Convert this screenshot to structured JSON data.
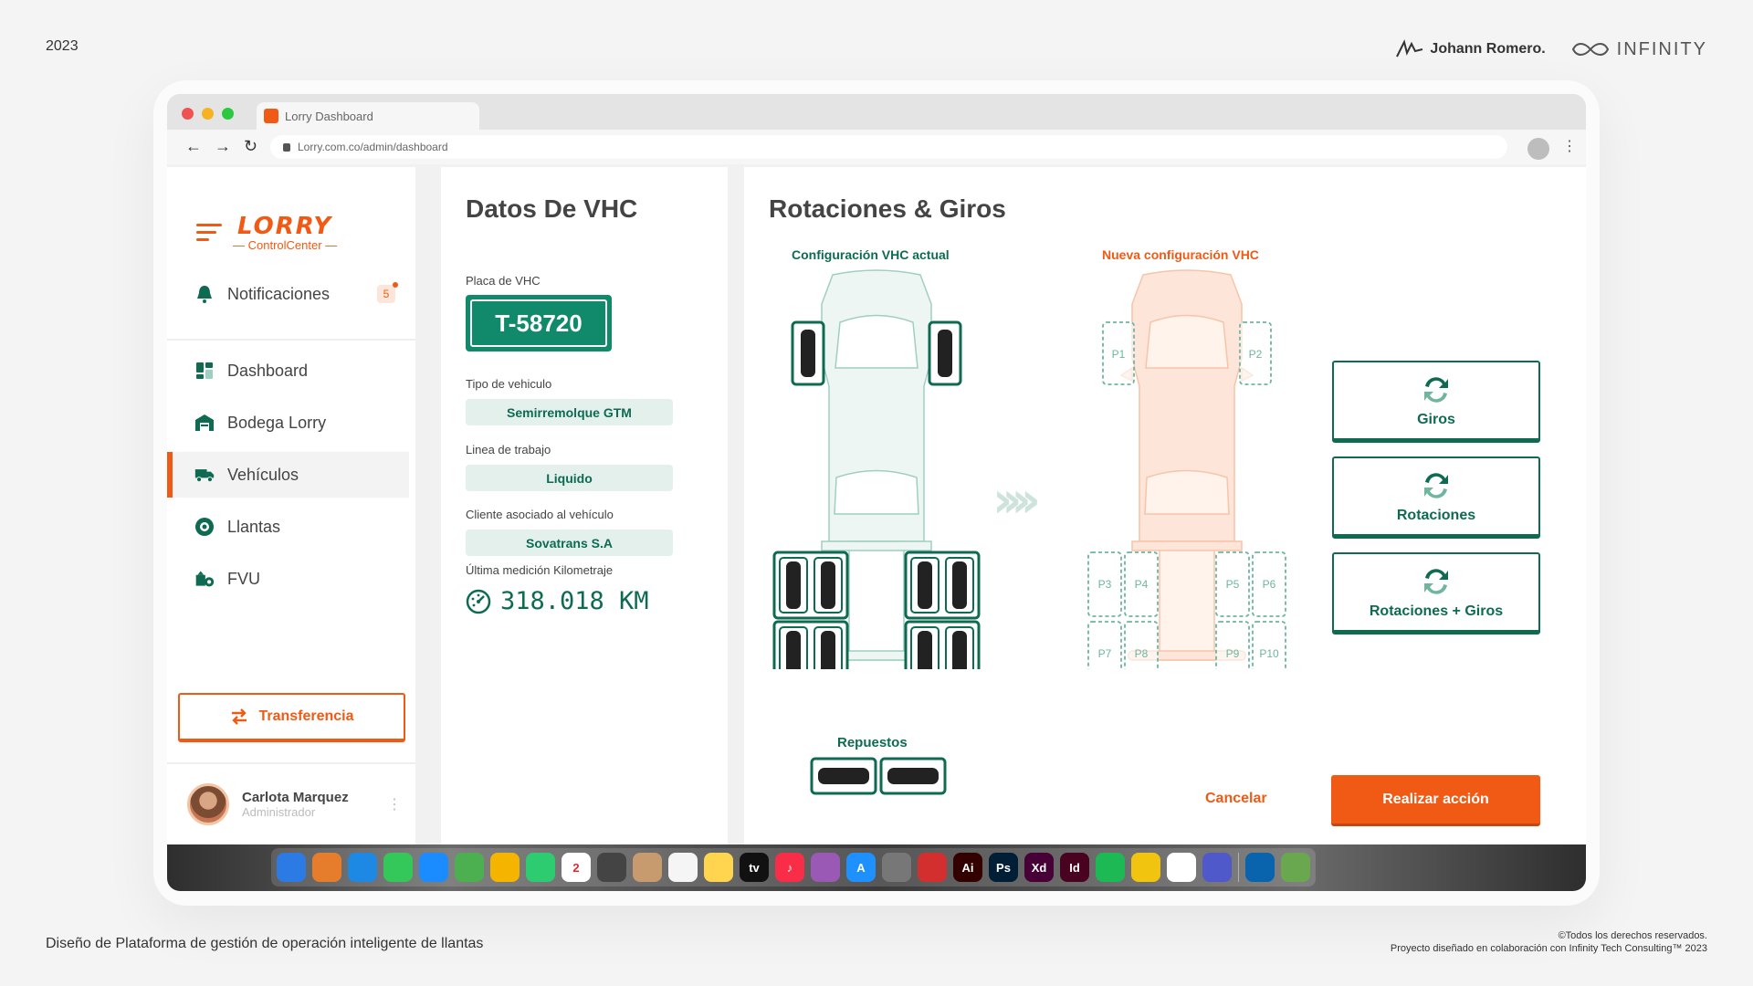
{
  "page": {
    "year": "2023",
    "designer": "Johann Romero.",
    "partner_brand": "INFINITY",
    "footer_left": "Diseño de Plataforma de gestión de operación inteligente de llantas",
    "footer_right_1": "©Todos los derechos reservados.",
    "footer_right_2": "Proyecto diseñado en colaboración con Infinity Tech Consulting™ 2023"
  },
  "browser": {
    "tab_title": "Lorry Dashboard",
    "url": "Lorry.com.co/admin/dashboard"
  },
  "colors": {
    "accent": "#f05a14",
    "green": "#0e6b52",
    "plate": "#108a6a",
    "pill_bg": "#e3f0ec"
  },
  "sidebar": {
    "logo_main": "LORRY",
    "logo_sub": "ControlCenter",
    "notifications_label": "Notificaciones",
    "notifications_count": "5",
    "items": [
      {
        "label": "Dashboard",
        "icon": "dashboard-icon"
      },
      {
        "label": "Bodega Lorry",
        "icon": "warehouse-icon"
      },
      {
        "label": "Vehículos",
        "icon": "truck-icon",
        "active": true
      },
      {
        "label": "Llantas",
        "icon": "tire-icon"
      },
      {
        "label": "FVU",
        "icon": "fvu-icon"
      }
    ],
    "transfer_label": "Transferencia",
    "user_name": "Carlota Marquez",
    "user_role": "Administrador"
  },
  "vhc": {
    "title": "Datos De VHC",
    "plate_label": "Placa de VHC",
    "plate": "T-58720",
    "type_label": "Tipo de vehiculo",
    "type": "Semirremolque GTM",
    "line_label": "Linea de trabajo",
    "line": "Liquido",
    "client_label": "Cliente asociado al vehículo",
    "client": "Sovatrans S.A",
    "km_label": "Última medición Kilometraje",
    "km": "318.018 KM"
  },
  "rotations": {
    "title": "Rotaciones & Giros",
    "current_label": "Configuración VHC actual",
    "new_label": "Nueva configuración VHC",
    "spares_label": "Repuestos",
    "positions": [
      "P1",
      "P2",
      "P3",
      "P4",
      "P5",
      "P6",
      "P7",
      "P8",
      "P9",
      "P10"
    ],
    "actions": [
      "Giros",
      "Rotaciones",
      "Rotaciones + Giros"
    ],
    "cancel_label": "Cancelar",
    "submit_label": "Realizar acción"
  },
  "dock": {
    "apps": [
      {
        "name": "finder",
        "color": "#2c7be5",
        "text": ""
      },
      {
        "name": "launchpad",
        "color": "#e57d2c",
        "text": ""
      },
      {
        "name": "safari",
        "color": "#1e88e5",
        "text": ""
      },
      {
        "name": "messages",
        "color": "#34c759",
        "text": ""
      },
      {
        "name": "mail",
        "color": "#1a8cff",
        "text": ""
      },
      {
        "name": "maps",
        "color": "#4caf50",
        "text": ""
      },
      {
        "name": "photos",
        "color": "#f4b400",
        "text": ""
      },
      {
        "name": "facetime",
        "color": "#2ecc71",
        "text": ""
      },
      {
        "name": "calendar",
        "color": "#ffffff",
        "text": "2"
      },
      {
        "name": "calculator",
        "color": "#444444",
        "text": ""
      },
      {
        "name": "contacts",
        "color": "#c79b6d",
        "text": ""
      },
      {
        "name": "reminders",
        "color": "#f5f5f5",
        "text": ""
      },
      {
        "name": "notes",
        "color": "#ffd54f",
        "text": ""
      },
      {
        "name": "tv",
        "color": "#111111",
        "text": "tv"
      },
      {
        "name": "music",
        "color": "#fa2d48",
        "text": "♪"
      },
      {
        "name": "podcasts",
        "color": "#9b59b6",
        "text": ""
      },
      {
        "name": "app-store",
        "color": "#1e90ff",
        "text": "A"
      },
      {
        "name": "system-settings",
        "color": "#777777",
        "text": ""
      },
      {
        "name": "acrobat",
        "color": "#d32f2f",
        "text": ""
      },
      {
        "name": "illustrator",
        "color": "#330000",
        "text": "Ai"
      },
      {
        "name": "photoshop",
        "color": "#001e36",
        "text": "Ps"
      },
      {
        "name": "xd",
        "color": "#470137",
        "text": "Xd"
      },
      {
        "name": "indesign",
        "color": "#49021f",
        "text": "Id"
      },
      {
        "name": "spotify",
        "color": "#1db954",
        "text": ""
      },
      {
        "name": "chrome",
        "color": "#f1c40f",
        "text": ""
      },
      {
        "name": "creative-cloud",
        "color": "#ffffff",
        "text": ""
      },
      {
        "name": "teams",
        "color": "#5059c9",
        "text": ""
      },
      {
        "name": "outlook",
        "color": "#0a64ad",
        "text": ""
      },
      {
        "name": "preview",
        "color": "#6aa84f",
        "text": ""
      }
    ]
  }
}
